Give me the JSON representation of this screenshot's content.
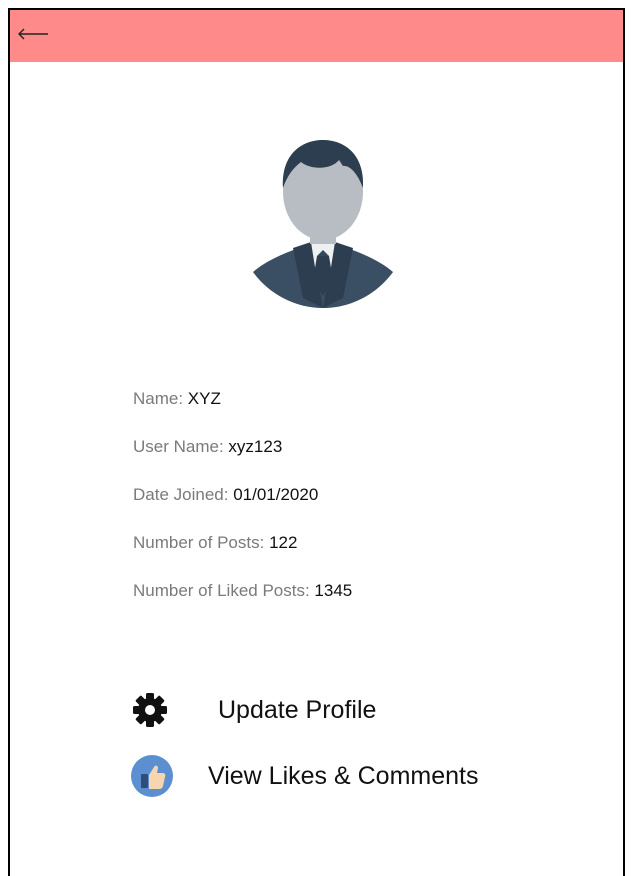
{
  "header": {
    "back_icon": "left-arrow-icon",
    "color": "#ff8a8a"
  },
  "profile": {
    "avatar_icon": "user-avatar-icon",
    "fields": [
      {
        "label": "Name: ",
        "value": "XYZ"
      },
      {
        "label": "User Name: ",
        "value": "xyz123"
      },
      {
        "label": "Date Joined: ",
        "value": "01/01/2020"
      },
      {
        "label": "Number of Posts: ",
        "value": "122"
      },
      {
        "label": "Number of Liked Posts: ",
        "value": "1345"
      }
    ]
  },
  "actions": {
    "update_profile": {
      "label": "Update Profile",
      "icon": "gear-icon"
    },
    "view_likes": {
      "label": "View Likes & Comments",
      "icon": "thumbs-up-icon"
    }
  }
}
